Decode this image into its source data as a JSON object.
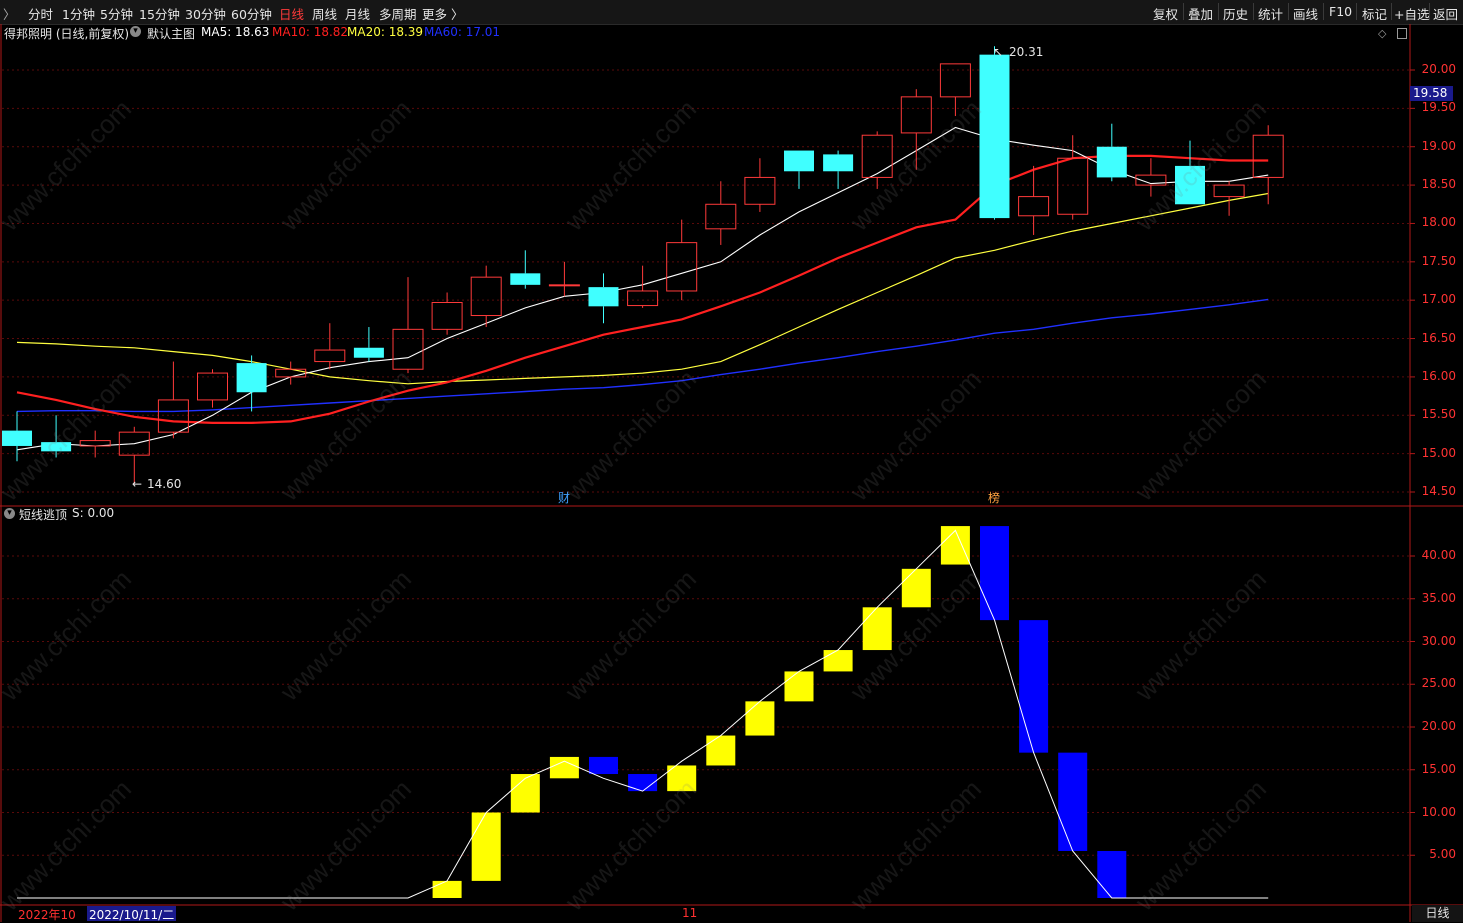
{
  "toolbar": {
    "menu_glyph": "〉",
    "periods": [
      "分时",
      "1分钟",
      "5分钟",
      "15分钟",
      "30分钟",
      "60分钟",
      "日线",
      "周线",
      "月线",
      "多周期",
      "更多 〉"
    ],
    "active_period": "日线",
    "tools": [
      "复权",
      "叠加",
      "历史",
      "统计",
      "画线",
      "F10",
      "标记",
      "+自选",
      "返回"
    ]
  },
  "main_panel": {
    "stock_name": "得邦照明",
    "mode": "(日线,前复权)",
    "template": "默认主图",
    "ma": [
      {
        "label": "MA5: 18.63",
        "color": "#ffffff"
      },
      {
        "label": "MA10: 18.82",
        "color": "#ff2020"
      },
      {
        "label": "MA20: 18.39",
        "color": "#ffff40"
      },
      {
        "label": "MA60: 17.01",
        "color": "#2030ff"
      }
    ],
    "high_label": "20.31",
    "low_label": "14.60",
    "current_price_tag": "19.58",
    "event_markers": [
      "财",
      "榜"
    ],
    "price_axis": [
      "20.00",
      "19.50",
      "19.00",
      "18.50",
      "18.00",
      "17.50",
      "17.00",
      "16.50",
      "16.00",
      "15.50",
      "15.00",
      "14.50"
    ]
  },
  "indicator_panel": {
    "title": "短线逃顶",
    "value": "S: 0.00",
    "axis": [
      "40.00",
      "35.00",
      "30.00",
      "25.00",
      "20.00",
      "15.00",
      "10.00",
      "5.00"
    ]
  },
  "bottom_bar": {
    "year_month": "2022年10",
    "cursor_date": "2022/10/11/二",
    "month_tick": "11",
    "period_label": "日线"
  },
  "watermark": "www.cfchi.com",
  "chart_data": [
    {
      "type": "candlestick",
      "title": "得邦照明 (日线,前复权)",
      "ylim": [
        14.5,
        20.0
      ],
      "up_color": "#ff3a3a",
      "down_color": "#40ffff",
      "candles": [
        {
          "o": 15.3,
          "h": 15.55,
          "l": 14.9,
          "c": 15.1
        },
        {
          "o": 15.15,
          "h": 15.5,
          "l": 14.95,
          "c": 15.03
        },
        {
          "o": 15.1,
          "h": 15.3,
          "l": 14.95,
          "c": 15.17
        },
        {
          "o": 14.98,
          "h": 15.35,
          "l": 14.6,
          "c": 15.28
        },
        {
          "o": 15.28,
          "h": 16.2,
          "l": 15.2,
          "c": 15.7
        },
        {
          "o": 15.7,
          "h": 16.1,
          "l": 15.6,
          "c": 16.05
        },
        {
          "o": 16.18,
          "h": 16.28,
          "l": 15.55,
          "c": 15.8
        },
        {
          "o": 16.0,
          "h": 16.2,
          "l": 15.9,
          "c": 16.1
        },
        {
          "o": 16.2,
          "h": 16.7,
          "l": 16.1,
          "c": 16.35
        },
        {
          "o": 16.38,
          "h": 16.65,
          "l": 16.2,
          "c": 16.25
        },
        {
          "o": 16.1,
          "h": 17.3,
          "l": 16.05,
          "c": 16.62
        },
        {
          "o": 16.62,
          "h": 17.1,
          "l": 16.55,
          "c": 16.97
        },
        {
          "o": 16.8,
          "h": 17.45,
          "l": 16.65,
          "c": 17.3
        },
        {
          "o": 17.35,
          "h": 17.65,
          "l": 17.15,
          "c": 17.2
        },
        {
          "o": 17.2,
          "h": 17.5,
          "l": 17.05,
          "c": 17.2
        },
        {
          "o": 17.17,
          "h": 17.35,
          "l": 16.7,
          "c": 16.92
        },
        {
          "o": 16.93,
          "h": 17.45,
          "l": 16.9,
          "c": 17.12
        },
        {
          "o": 17.12,
          "h": 18.05,
          "l": 17.0,
          "c": 17.75
        },
        {
          "o": 17.93,
          "h": 18.55,
          "l": 17.72,
          "c": 18.25
        },
        {
          "o": 18.25,
          "h": 18.85,
          "l": 18.15,
          "c": 18.6
        },
        {
          "o": 18.95,
          "h": 18.95,
          "l": 18.45,
          "c": 18.68
        },
        {
          "o": 18.9,
          "h": 18.95,
          "l": 18.45,
          "c": 18.68
        },
        {
          "o": 18.6,
          "h": 19.2,
          "l": 18.45,
          "c": 19.15
        },
        {
          "o": 19.18,
          "h": 19.75,
          "l": 18.7,
          "c": 19.65
        },
        {
          "o": 19.65,
          "h": 20.08,
          "l": 19.4,
          "c": 20.08
        },
        {
          "o": 20.2,
          "h": 20.31,
          "l": 18.05,
          "c": 18.07
        },
        {
          "o": 18.1,
          "h": 18.75,
          "l": 17.85,
          "c": 18.35
        },
        {
          "o": 18.12,
          "h": 19.15,
          "l": 18.05,
          "c": 18.85
        },
        {
          "o": 19.0,
          "h": 19.3,
          "l": 18.55,
          "c": 18.6
        },
        {
          "o": 18.5,
          "h": 18.85,
          "l": 18.35,
          "c": 18.63
        },
        {
          "o": 18.75,
          "h": 19.08,
          "l": 18.25,
          "c": 18.25
        },
        {
          "o": 18.35,
          "h": 18.55,
          "l": 18.1,
          "c": 18.5
        },
        {
          "o": 18.6,
          "h": 19.28,
          "l": 18.25,
          "c": 19.15
        }
      ],
      "ma5": [
        15.05,
        15.13,
        15.1,
        15.13,
        15.25,
        15.5,
        15.8,
        16.0,
        16.12,
        16.2,
        16.25,
        16.5,
        16.7,
        16.9,
        17.05,
        17.1,
        17.2,
        17.35,
        17.5,
        17.85,
        18.15,
        18.4,
        18.65,
        18.95,
        19.25,
        19.1,
        19.02,
        18.95,
        18.7,
        18.52,
        18.55,
        18.55,
        18.63
      ],
      "ma10": [
        15.8,
        15.7,
        15.58,
        15.48,
        15.42,
        15.4,
        15.4,
        15.42,
        15.52,
        15.68,
        15.82,
        15.93,
        16.08,
        16.25,
        16.4,
        16.55,
        16.65,
        16.75,
        16.92,
        17.1,
        17.32,
        17.55,
        17.75,
        17.95,
        18.05,
        18.5,
        18.7,
        18.85,
        18.88,
        18.88,
        18.85,
        18.82,
        18.82
      ],
      "ma20": [
        16.45,
        16.43,
        16.4,
        16.38,
        16.33,
        16.28,
        16.2,
        16.1,
        16.0,
        15.95,
        15.91,
        15.94,
        15.96,
        15.98,
        16.0,
        16.02,
        16.05,
        16.1,
        16.2,
        16.42,
        16.65,
        16.88,
        17.1,
        17.32,
        17.55,
        17.65,
        17.78,
        17.9,
        18.0,
        18.1,
        18.2,
        18.3,
        18.39
      ],
      "ma60": [
        15.55,
        15.56,
        15.56,
        15.55,
        15.55,
        15.57,
        15.6,
        15.63,
        15.66,
        15.69,
        15.72,
        15.75,
        15.78,
        15.81,
        15.84,
        15.86,
        15.9,
        15.95,
        16.03,
        16.1,
        16.18,
        16.25,
        16.33,
        16.4,
        16.48,
        16.57,
        16.62,
        16.7,
        16.77,
        16.82,
        16.88,
        16.94,
        17.01
      ]
    },
    {
      "type": "bar",
      "title": "短线逃顶",
      "ylim": [
        0,
        45
      ],
      "series": [
        {
          "name": "S",
          "values": [
            0,
            0,
            0,
            0,
            0,
            0,
            0,
            0,
            0,
            0,
            0,
            2,
            10,
            14,
            16,
            14,
            12.5,
            16,
            19,
            23,
            26.5,
            29,
            34,
            38.5,
            43,
            32.5,
            17,
            5.5,
            0,
            0,
            0,
            0,
            0
          ]
        }
      ],
      "bars": [
        {
          "i": 11,
          "from": 0,
          "to": 2,
          "color": "yellow"
        },
        {
          "i": 12,
          "from": 2,
          "to": 10,
          "color": "yellow"
        },
        {
          "i": 13,
          "from": 10,
          "to": 14.5,
          "color": "yellow"
        },
        {
          "i": 14,
          "from": 14,
          "to": 16.5,
          "color": "yellow"
        },
        {
          "i": 15,
          "from": 14.5,
          "to": 16.5,
          "color": "blue"
        },
        {
          "i": 16,
          "from": 12.5,
          "to": 14.5,
          "color": "blue"
        },
        {
          "i": 17,
          "from": 12.5,
          "to": 15.5,
          "color": "yellow"
        },
        {
          "i": 18,
          "from": 15.5,
          "to": 19,
          "color": "yellow"
        },
        {
          "i": 19,
          "from": 19,
          "to": 23,
          "color": "yellow"
        },
        {
          "i": 20,
          "from": 23,
          "to": 26.5,
          "color": "yellow"
        },
        {
          "i": 21,
          "from": 26.5,
          "to": 29,
          "color": "yellow"
        },
        {
          "i": 22,
          "from": 29,
          "to": 34,
          "color": "yellow"
        },
        {
          "i": 23,
          "from": 34,
          "to": 38.5,
          "color": "yellow"
        },
        {
          "i": 24,
          "from": 39,
          "to": 43.5,
          "color": "yellow"
        },
        {
          "i": 25,
          "from": 32.5,
          "to": 43.5,
          "color": "blue"
        },
        {
          "i": 26,
          "from": 17,
          "to": 32.5,
          "color": "blue"
        },
        {
          "i": 27,
          "from": 5.5,
          "to": 17,
          "color": "blue"
        },
        {
          "i": 28,
          "from": 0,
          "to": 5.5,
          "color": "blue"
        }
      ]
    }
  ]
}
